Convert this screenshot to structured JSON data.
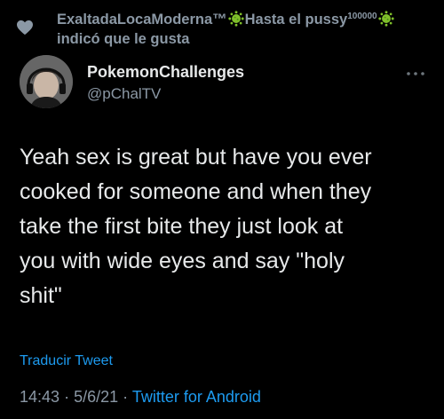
{
  "social_context": {
    "prefix": "ExaltadaLocaModerna™",
    "after_emoji_1": "Hasta el pussy",
    "superscript": "100000",
    "suffix": "indicó que le gusta"
  },
  "tweet": {
    "display_name": "PokemonChallenges",
    "handle": "@pChalTV",
    "text": "Yeah sex is great but have you ever\ncooked for someone and when they\ntake the first bite they just look at\nyou with wide eyes and say \"holy\nshit\"",
    "translate_label": "Traducir Tweet",
    "time": "14:43",
    "date": "5/6/21",
    "separator": "·",
    "source": "Twitter for Android"
  },
  "icons": {
    "like": "heart-icon",
    "virus": "virus-icon",
    "more": "more-options-icon"
  },
  "colors": {
    "background": "#000000",
    "text": "#e7e9ea",
    "secondary": "#8b98a5",
    "link": "#1d9bf0",
    "virus": "#7fbf2a"
  }
}
